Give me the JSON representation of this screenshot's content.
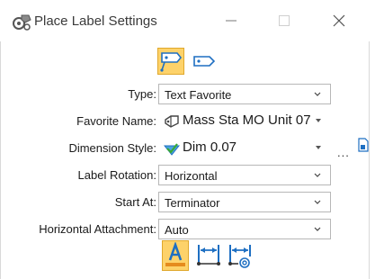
{
  "window": {
    "title": "Place Label Settings",
    "minimize_icon": "minimize-icon",
    "maximize_icon": "maximize-icon",
    "close_icon": "close-icon"
  },
  "mode_buttons": [
    {
      "name": "place-label-with-leader",
      "active": true
    },
    {
      "name": "place-label-tag",
      "active": false
    }
  ],
  "fields": {
    "type": {
      "label": "Type:",
      "value": "Text Favorite"
    },
    "favorite_name": {
      "label": "Favorite Name:",
      "value": "Mass Sta MO Unit 07"
    },
    "dimension_style": {
      "label": "Dimension Style:",
      "value": "Dim 0.07"
    },
    "label_rotation": {
      "label": "Label Rotation:",
      "value": "Horizontal"
    },
    "start_at": {
      "label": "Start At:",
      "value": "Terminator"
    },
    "horizontal_attachment": {
      "label": "Horizontal Attachment:",
      "value": "Auto"
    }
  },
  "more_button_label": "...",
  "bottom_buttons": [
    {
      "name": "annotation-text-icon",
      "active": true
    },
    {
      "name": "leader-dimension-icon",
      "active": false
    },
    {
      "name": "leader-at-icon",
      "active": false
    }
  ],
  "colors": {
    "active_bg": "#fdd26a",
    "active_border": "#e0a82c",
    "icon_blue": "#1e6fc2"
  }
}
